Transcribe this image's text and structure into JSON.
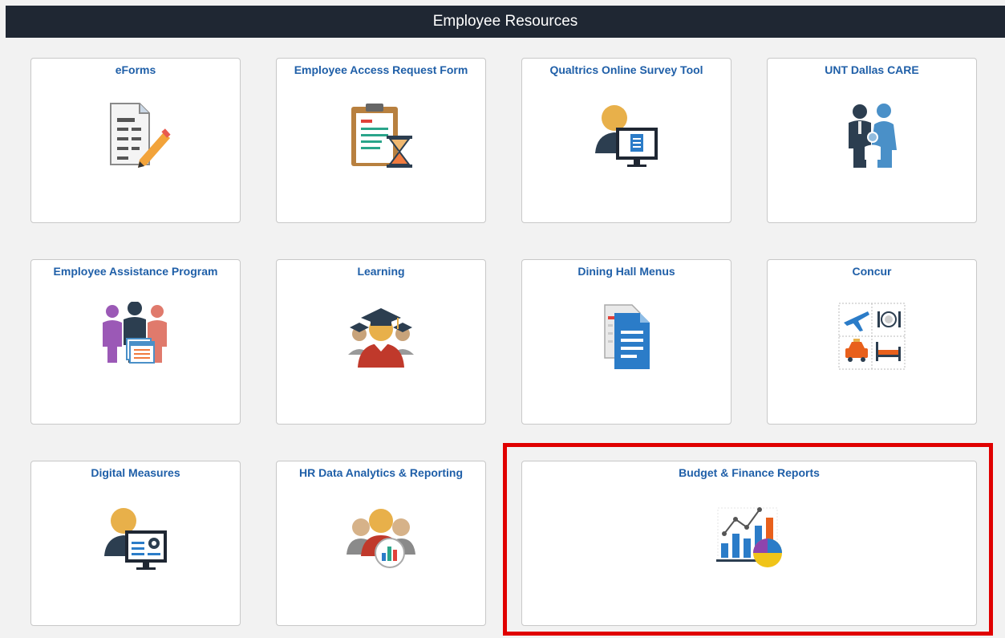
{
  "header": {
    "title": "Employee Resources"
  },
  "tiles": [
    {
      "title": "eForms",
      "icon": "document-pencil-icon"
    },
    {
      "title": "Employee Access Request Form",
      "icon": "clipboard-hourglass-icon"
    },
    {
      "title": "Qualtrics Online Survey Tool",
      "icon": "person-monitor-survey-icon"
    },
    {
      "title": "UNT Dallas CARE",
      "icon": "family-icon"
    },
    {
      "title": "Employee Assistance Program",
      "icon": "people-form-icon"
    },
    {
      "title": "Learning",
      "icon": "graduates-icon"
    },
    {
      "title": "Dining Hall Menus",
      "icon": "menu-documents-icon"
    },
    {
      "title": "Concur",
      "icon": "travel-expense-icon"
    },
    {
      "title": "Digital Measures",
      "icon": "person-monitor-settings-icon"
    },
    {
      "title": "HR Data Analytics & Reporting",
      "icon": "people-analytics-icon"
    },
    {
      "title": "Budget & Finance Reports",
      "icon": "charts-report-icon"
    }
  ],
  "highlighted_tile": "Budget & Finance Reports",
  "colors": {
    "header_bg": "#1f2733",
    "tile_title": "#1f5fa8",
    "highlight": "#e00000",
    "page_bg": "#f2f2f2"
  }
}
